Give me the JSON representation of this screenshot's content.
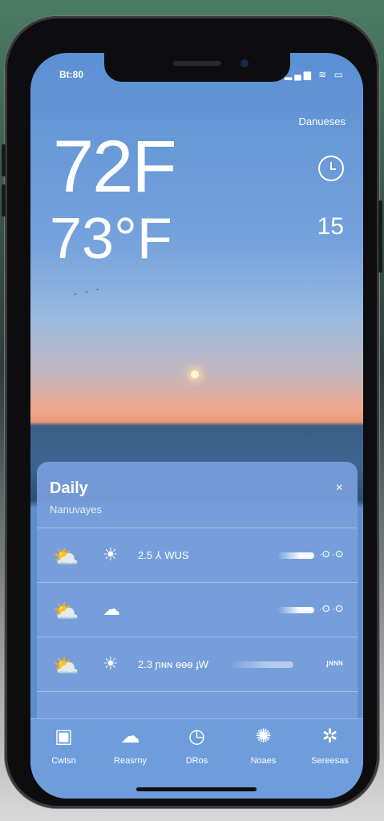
{
  "status": {
    "time": "Bt:80",
    "icons": "▂▄▆ ≋ ▭"
  },
  "header": {
    "location": "Danueses",
    "temperature": "72F",
    "feels_like": "73°F",
    "side_value": "15"
  },
  "daily": {
    "title": "Daily",
    "subtitle": "Nanuvayes",
    "close": "×",
    "rows": [
      {
        "icon_left": "⛅",
        "icon_right": "☀",
        "text": "2.5 ⅄ WUS",
        "right": "·ⵙ ·ⵙ"
      },
      {
        "icon_left": "⛅",
        "icon_right": "☁",
        "text": "",
        "right": "·ⵙ ·ⵙ"
      },
      {
        "icon_left": "⛅",
        "icon_right": "☀",
        "text": "2.3 ɲɴɴ ɵɵɵ ɟW",
        "right": "ɟɴɴɴ"
      }
    ]
  },
  "tabs": [
    {
      "icon": "▣",
      "label": "Cwtsn",
      "name": "tab-current"
    },
    {
      "icon": "☁",
      "label": "Reasrny",
      "name": "tab-forecast"
    },
    {
      "icon": "◷",
      "label": "DRos",
      "name": "tab-radar"
    },
    {
      "icon": "✺",
      "label": "Noaes",
      "name": "tab-news"
    },
    {
      "icon": "✲",
      "label": "Sereesas",
      "name": "tab-settings"
    }
  ],
  "colors": {
    "sky_top": "#5b8fd4",
    "sunset": "#f1a58a",
    "card": "#78a0dc",
    "tabbar": "#6f9ddb"
  }
}
